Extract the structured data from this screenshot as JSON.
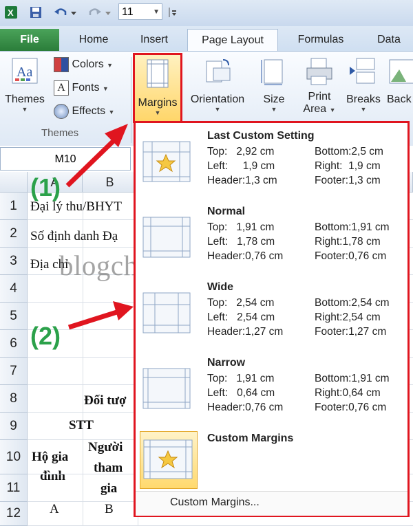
{
  "qat": {
    "font_size": "11"
  },
  "tabs": [
    "File",
    "Home",
    "Insert",
    "Page Layout",
    "Formulas",
    "Data"
  ],
  "ribbon": {
    "themes": "Themes",
    "colors": "Colors",
    "fonts": "Fonts",
    "effects": "Effects",
    "group_themes": "Themes",
    "margins": "Margins",
    "orientation": "Orientation",
    "size": "Size",
    "print_area_1": "Print",
    "print_area_2": "Area",
    "breaks": "Breaks",
    "background": "Back"
  },
  "name_box": "M10",
  "grid": {
    "col_a": "A",
    "col_b": "B",
    "rows": [
      "1",
      "2",
      "3",
      "4",
      "5",
      "6",
      "7",
      "8",
      "9",
      "10",
      "11",
      "12"
    ],
    "cells": {
      "r1": "Đại lý thu/BHYT",
      "r2": "Số định danh Đạ",
      "r3": "Địa chỉ",
      "r8": "Đối tượ",
      "r9": "STT",
      "r10a1": "Hộ gia",
      "r10a2": "đình",
      "r10b1": "Người",
      "r10b2": "tham",
      "r10b3": "gia",
      "r12a": "A",
      "r12b": "B"
    }
  },
  "annotations": {
    "label1": "(1)",
    "label2": "(2)",
    "watermark": "blogchiasekienthuc.com"
  },
  "margins_menu": {
    "options": [
      {
        "title": "Last Custom Setting",
        "top": "Top:   2,92 cm",
        "bottom": "Bottom:2,5 cm",
        "left": "Left:     1,9 cm",
        "right": "Right:  1,9 cm",
        "header": "Header:1,3 cm",
        "footer": "Footer:1,3 cm"
      },
      {
        "title": "Normal",
        "top": "Top:   1,91 cm",
        "bottom": "Bottom:1,91 cm",
        "left": "Left:   1,78 cm",
        "right": "Right:1,78 cm",
        "header": "Header:0,76 cm",
        "footer": "Footer:0,76 cm"
      },
      {
        "title": "Wide",
        "top": "Top:   2,54 cm",
        "bottom": "Bottom:2,54 cm",
        "left": "Left:   2,54 cm",
        "right": "Right:2,54 cm",
        "header": "Header:1,27 cm",
        "footer": "Footer:1,27 cm"
      },
      {
        "title": "Narrow",
        "top": "Top:   1,91 cm",
        "bottom": "Bottom:1,91 cm",
        "left": "Left:   0,64 cm",
        "right": "Right:0,64 cm",
        "header": "Header:0,76 cm",
        "footer": "Footer:0,76 cm"
      }
    ],
    "custom_title": "Custom Margins",
    "custom_link": "Custom Margins..."
  },
  "colors": {
    "highlight_red": "#e0151f",
    "annotation_green": "#2ba14a"
  }
}
